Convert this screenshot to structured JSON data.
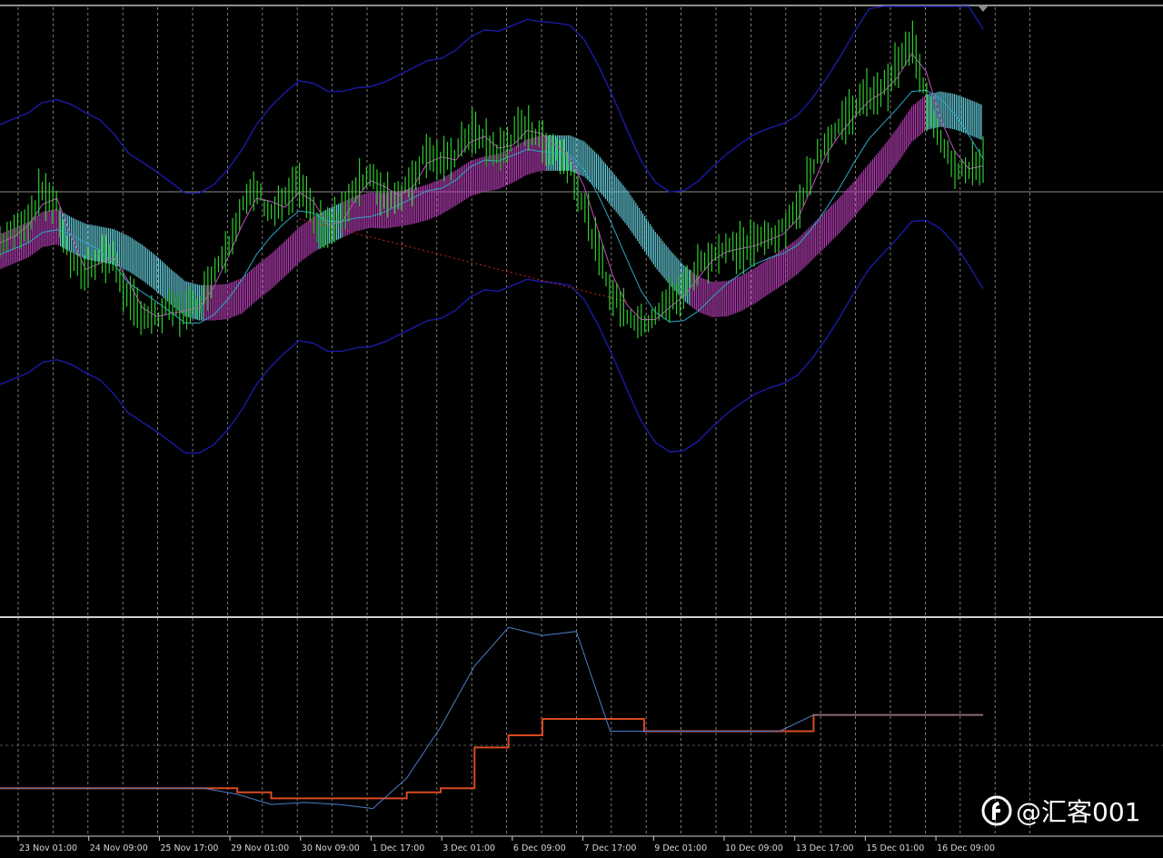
{
  "chart_data": {
    "type": "candlestick-with-indicators",
    "x_axis": {
      "tick_labels": [
        "23 Nov 01:00",
        "24 Nov 09:00",
        "25 Nov 17:00",
        "29 Nov 01:00",
        "30 Nov 09:00",
        "1 Dec 17:00",
        "3 Dec 01:00",
        "6 Dec 09:00",
        "7 Dec 17:00",
        "9 Dec 01:00",
        "10 Dec 09:00",
        "13 Dec 17:00",
        "15 Dec 01:00",
        "16 Dec 09:00"
      ]
    },
    "grid": true,
    "main_panel": {
      "price_series": [
        0.62,
        0.64,
        0.66,
        0.71,
        0.68,
        0.58,
        0.57,
        0.6,
        0.59,
        0.52,
        0.5,
        0.49,
        0.51,
        0.5,
        0.52,
        0.57,
        0.62,
        0.68,
        0.71,
        0.67,
        0.69,
        0.72,
        0.66,
        0.64,
        0.67,
        0.72,
        0.73,
        0.7,
        0.7,
        0.73,
        0.78,
        0.75,
        0.77,
        0.81,
        0.79,
        0.77,
        0.8,
        0.82,
        0.79,
        0.78,
        0.75,
        0.68,
        0.6,
        0.53,
        0.5,
        0.48,
        0.5,
        0.52,
        0.54,
        0.58,
        0.6,
        0.61,
        0.61,
        0.62,
        0.63,
        0.64,
        0.68,
        0.75,
        0.79,
        0.82,
        0.85,
        0.87,
        0.88,
        0.92,
        0.96,
        0.86,
        0.8,
        0.75,
        0.74,
        0.76
      ],
      "colors": {
        "candles": "#2ecc2e",
        "upper_band": "#1a1aa8",
        "lower_band": "#1a1aa8",
        "middle_line": "#2aa6c8",
        "fast_ma": "#c24cc2",
        "cloud_bull": "#b03cb0",
        "cloud_bear": "#63c9d6",
        "horizontal_line": "#8a8a8a",
        "trend_line": "#d02020"
      }
    },
    "lower_panel": {
      "series": [
        {
          "color": "#d84a20",
          "values": [
            0.2,
            0.2,
            0.2,
            0.2,
            0.2,
            0.2,
            0.2,
            0.18,
            0.15,
            0.15,
            0.15,
            0.15,
            0.18,
            0.2,
            0.4,
            0.46,
            0.54,
            0.54,
            0.54,
            0.48,
            0.48,
            0.48,
            0.48,
            0.48,
            0.56,
            0.56,
            0.56,
            0.56,
            0.56,
            0.56
          ]
        },
        {
          "color": "#4a7fc8",
          "values": [
            0.2,
            0.2,
            0.2,
            0.2,
            0.2,
            0.2,
            0.2,
            0.17,
            0.12,
            0.13,
            0.12,
            0.1,
            0.25,
            0.5,
            0.8,
            0.99,
            0.95,
            0.97,
            0.48,
            0.48,
            0.48,
            0.48,
            0.48,
            0.48,
            0.56,
            0.56,
            0.56,
            0.56,
            0.56,
            0.56
          ]
        }
      ]
    }
  },
  "watermark": {
    "text": "@汇客001"
  }
}
